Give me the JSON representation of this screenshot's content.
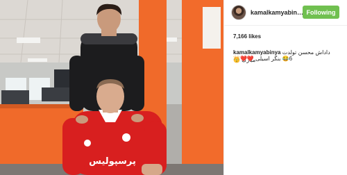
{
  "post": {
    "username": "kamalkamyabin…",
    "follow_label": "Following",
    "likes": "7,166 likes",
    "caption": {
      "user": "kamalkamyabinya",
      "line1": "داداش محسن تولدت مبارک 😍",
      "line2": "6😂 بنگر اسیلی ❤️❤️👑"
    }
  },
  "photo": {
    "shirt_text": "پرسپولیس"
  },
  "colors": {
    "follow_bg": "#70c050",
    "wall_orange": "#f06a2a",
    "jersey_red": "#d81f1f"
  }
}
